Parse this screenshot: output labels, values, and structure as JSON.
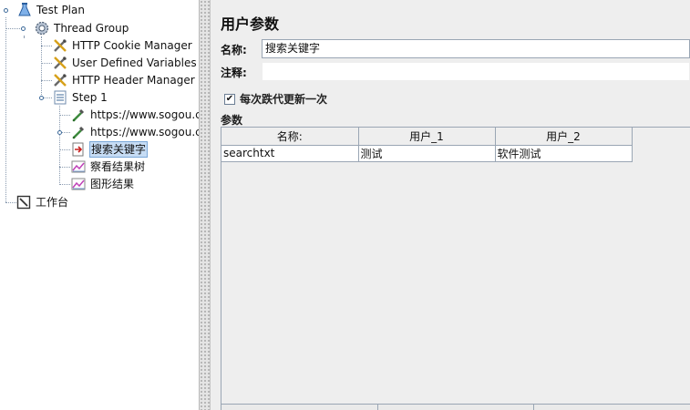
{
  "tree": {
    "test_plan": "Test Plan",
    "thread_group": "Thread Group",
    "cookie_manager": "HTTP Cookie Manager",
    "user_vars": "User Defined Variables",
    "header_manager": "HTTP Header Manager",
    "step1": "Step 1",
    "sampler1": "https://www.sogou.com",
    "sampler2": "https://www.sogou.com",
    "user_params": "搜索关键字",
    "result_tree": "察看结果树",
    "graph_results": "图形结果",
    "workbench": "工作台"
  },
  "panel": {
    "title": "用户参数",
    "name_label": "名称:",
    "name_value": "搜索关键字",
    "comment_label": "注释:",
    "comment_value": "",
    "iteration_label": "每次跌代更新一次",
    "iteration_checked": true,
    "params_label": "参数"
  },
  "table": {
    "headers": [
      "名称:",
      "用户_1",
      "用户_2"
    ],
    "rows": [
      [
        "searchtxt",
        "测试",
        "软件测试"
      ]
    ]
  },
  "colors": {
    "selection": "#c6dcf4",
    "border": "#9aa6b4",
    "panel_bg": "#eeeeee"
  }
}
